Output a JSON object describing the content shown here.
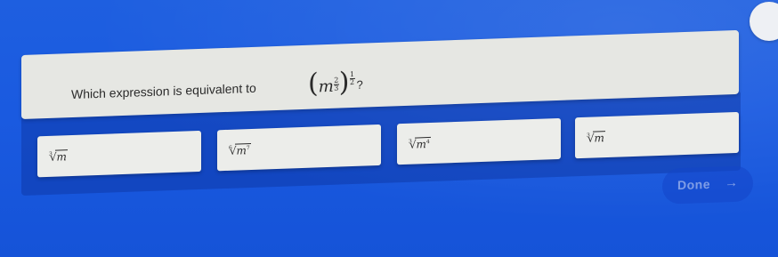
{
  "question": {
    "prompt": "Which expression is equivalent to",
    "base": "m",
    "inner_exp_num": "2",
    "inner_exp_den": "3",
    "outer_exp_num": "1",
    "outer_exp_den": "2",
    "trailing": "?"
  },
  "options": [
    {
      "index": "3",
      "radicand": "m",
      "power": ""
    },
    {
      "index": "6",
      "radicand": "m",
      "power": "7"
    },
    {
      "index": "3",
      "radicand": "m",
      "power": "4"
    },
    {
      "index": "3",
      "radicand": "m",
      "power": ""
    }
  ],
  "done": {
    "label": "Done",
    "arrow_icon": "arrow-right-icon"
  },
  "colors": {
    "background": "#1a5ae0",
    "card": "#e6e7e3"
  }
}
